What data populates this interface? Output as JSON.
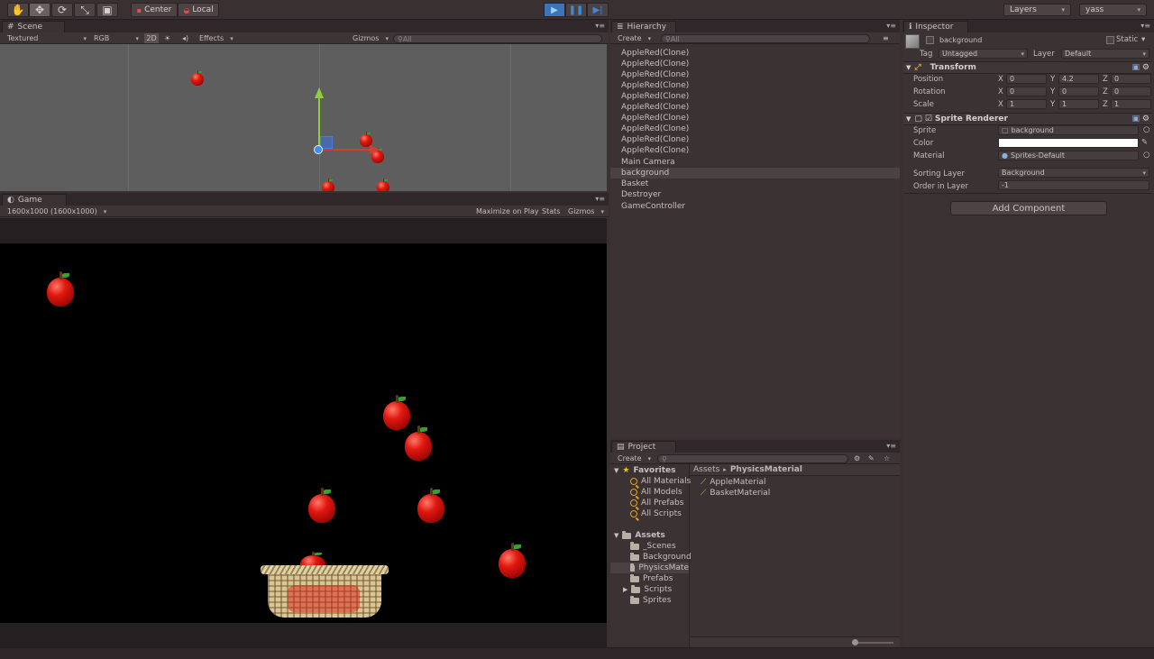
{
  "toolbar": {
    "tools": [
      "hand-icon",
      "move-icon",
      "rotate-icon",
      "scale-icon",
      "rect-icon"
    ],
    "pivot": "Center",
    "space": "Local",
    "layers": "Layers",
    "layout": "yass"
  },
  "scene": {
    "tab": "Scene",
    "shading": "Textured",
    "render": "RGB",
    "mode2d": "2D",
    "effects": "Effects",
    "gizmos": "Gizmos",
    "search": "All"
  },
  "game": {
    "tab": "Game",
    "resolution": "1600x1000 (1600x1000)",
    "maximize": "Maximize on Play",
    "stats": "Stats",
    "gizmos": "Gizmos"
  },
  "hierarchy": {
    "tab": "Hierarchy",
    "create": "Create",
    "search": "All",
    "items": [
      "AppleRed(Clone)",
      "AppleRed(Clone)",
      "AppleRed(Clone)",
      "AppleRed(Clone)",
      "AppleRed(Clone)",
      "AppleRed(Clone)",
      "AppleRed(Clone)",
      "AppleRed(Clone)",
      "AppleRed(Clone)",
      "AppleRed(Clone)",
      "Main Camera",
      "background",
      "Basket",
      "Destroyer",
      "GameController"
    ],
    "selected": "background"
  },
  "inspector": {
    "tab": "Inspector",
    "object_name": "background",
    "static": "Static",
    "tag_label": "Tag",
    "tag": "Untagged",
    "layer_label": "Layer",
    "layer": "Default",
    "transform": {
      "title": "Transform",
      "position_label": "Position",
      "position": {
        "x": "0",
        "y": "4.2",
        "z": "0"
      },
      "rotation_label": "Rotation",
      "rotation": {
        "x": "0",
        "y": "0",
        "z": "0"
      },
      "scale_label": "Scale",
      "scale": {
        "x": "1",
        "y": "1",
        "z": "1"
      }
    },
    "sprite_renderer": {
      "title": "Sprite Renderer",
      "sprite_label": "Sprite",
      "sprite": "background",
      "color_label": "Color",
      "color": "#ffffff",
      "material_label": "Material",
      "material": "Sprites-Default",
      "sorting_layer_label": "Sorting Layer",
      "sorting_layer": "Background",
      "order_label": "Order in Layer",
      "order": "-1"
    },
    "add_component": "Add Component"
  },
  "project": {
    "tab": "Project",
    "create": "Create",
    "favorites": "Favorites",
    "favorite_items": [
      "All Materials",
      "All Models",
      "All Prefabs",
      "All Scripts"
    ],
    "assets": "Assets",
    "asset_folders": [
      "_Scenes",
      "Background",
      "PhysicsMate",
      "Prefabs",
      "Scripts",
      "Sprites"
    ],
    "selected_folder": "PhysicsMate",
    "breadcrumb_root": "Assets",
    "breadcrumb_current": "PhysicsMaterial",
    "files": [
      "AppleMaterial",
      "BasketMaterial"
    ]
  },
  "axes": [
    "X",
    "Y",
    "Z"
  ]
}
